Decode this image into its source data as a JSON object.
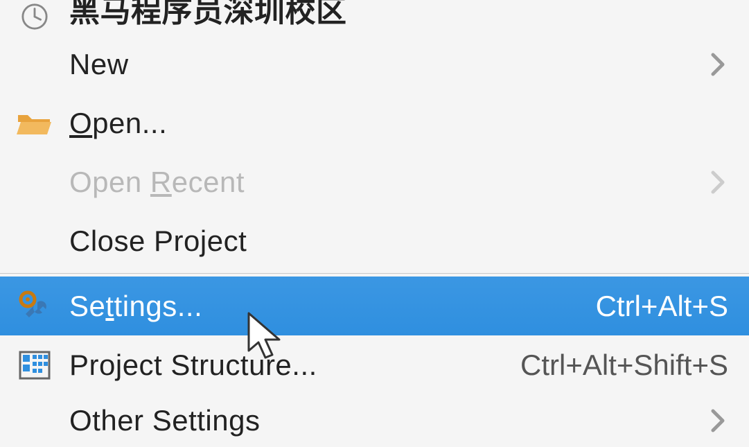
{
  "menu": {
    "projectTitle": "黑马程序员深圳校区",
    "items": {
      "new": {
        "label": "New",
        "hasSubmenu": true
      },
      "open": {
        "prefix": "",
        "mnemo": "O",
        "rest": "pen..."
      },
      "openRecent": {
        "prefix": "Open ",
        "mnemo": "R",
        "rest": "ecent",
        "hasSubmenu": true,
        "disabled": true
      },
      "closeProject": {
        "label": "Close Project"
      },
      "settings": {
        "prefix": "Se",
        "mnemo": "t",
        "rest": "tings...",
        "shortcut": "Ctrl+Alt+S",
        "selected": true
      },
      "projectStructure": {
        "label": "Project Structure...",
        "shortcut": "Ctrl+Alt+Shift+S"
      },
      "otherSettings": {
        "label": "Other Settings",
        "hasSubmenu": true
      }
    }
  }
}
